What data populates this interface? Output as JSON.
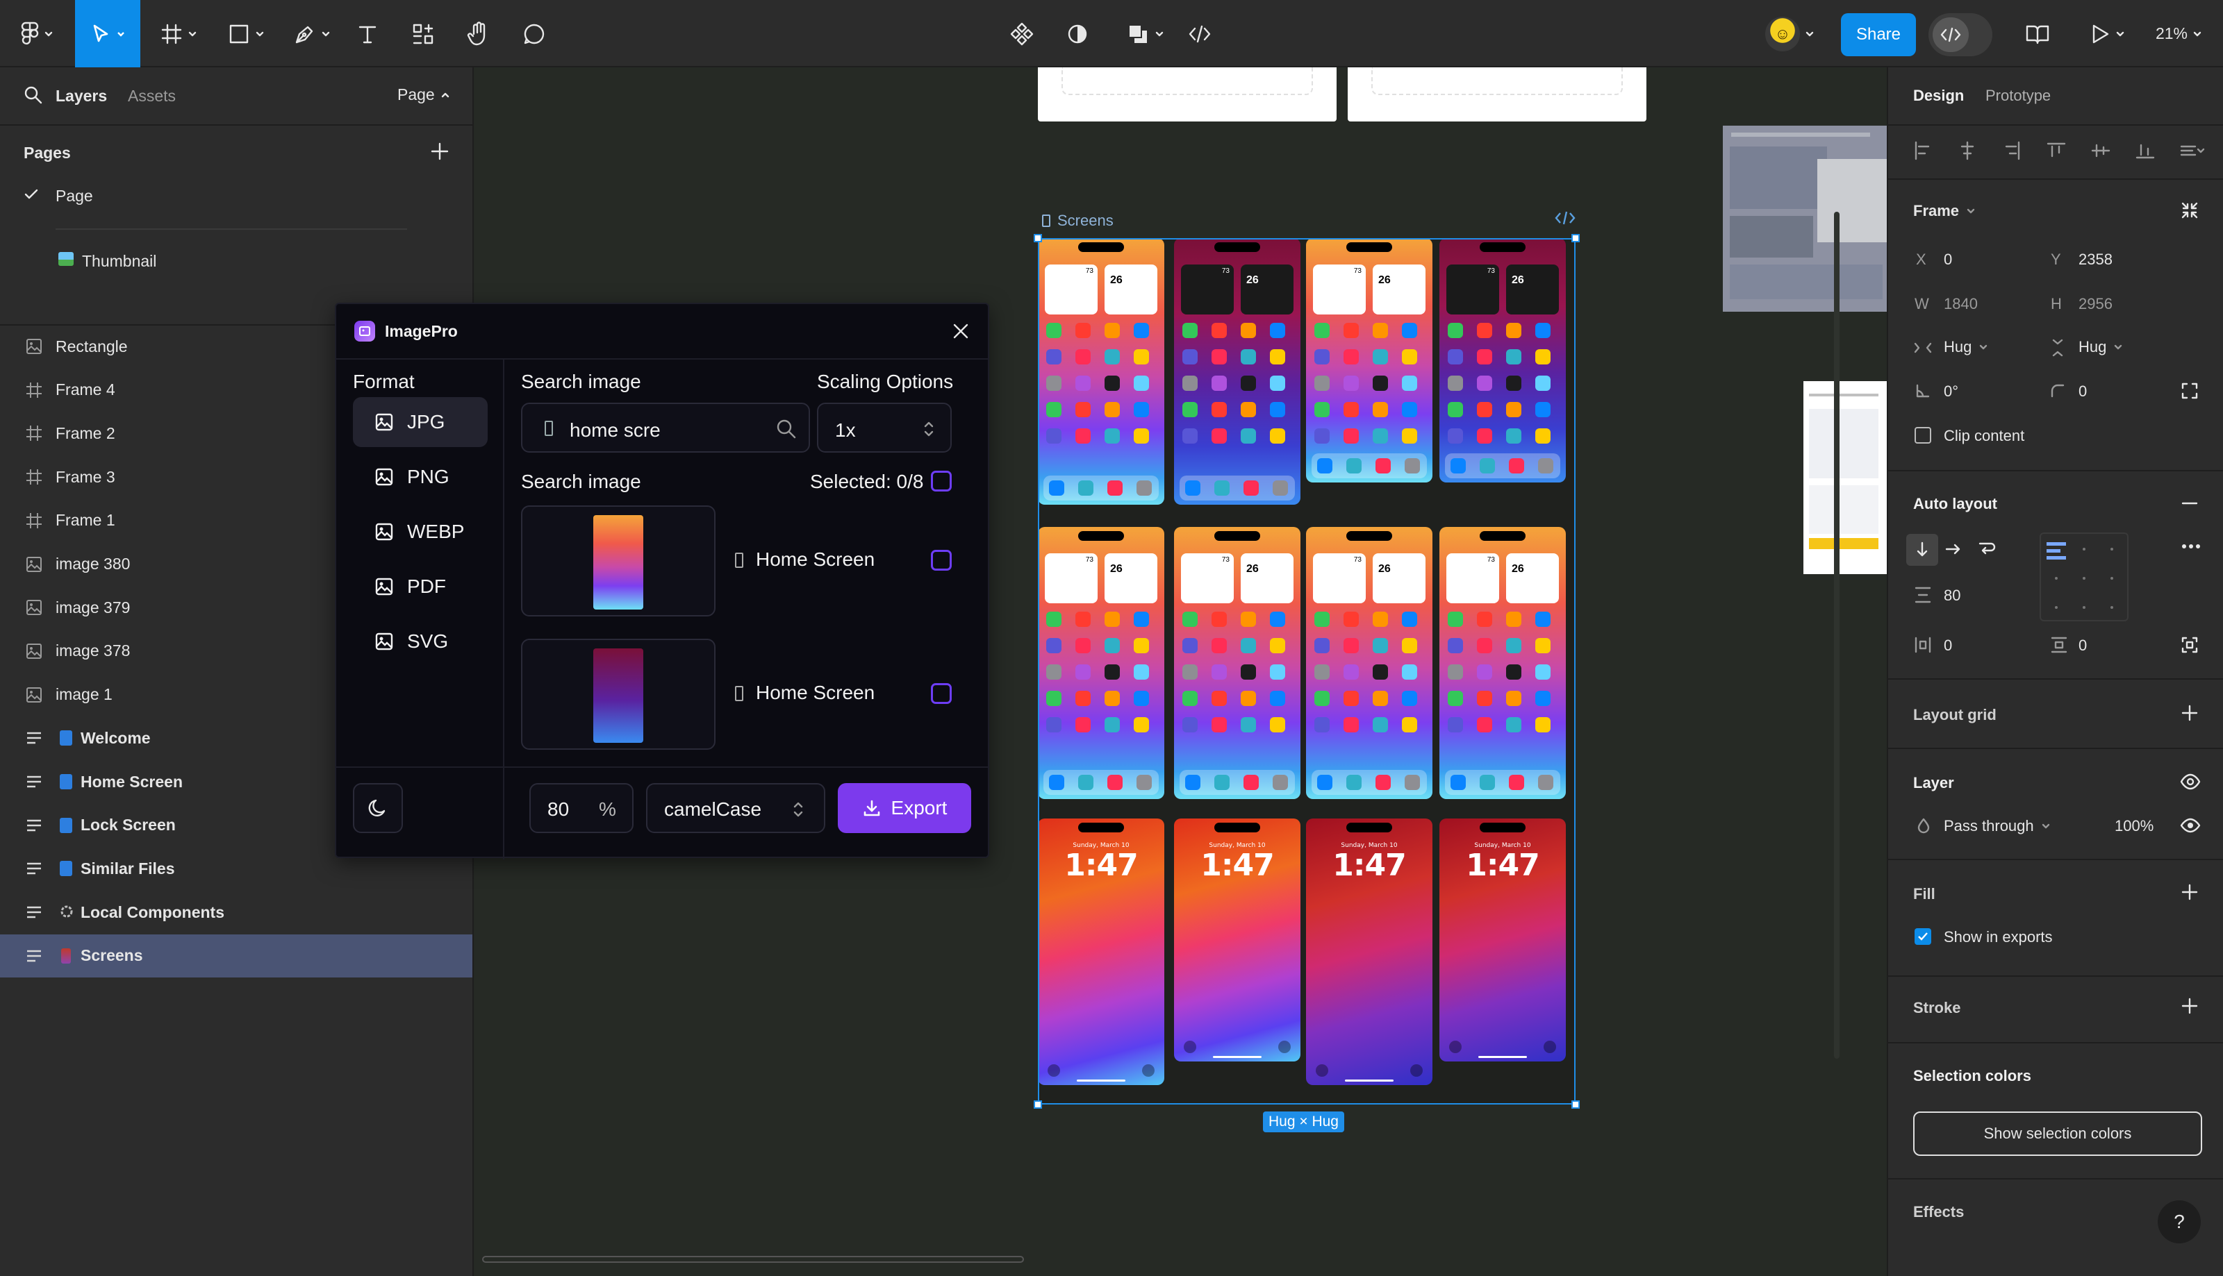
{
  "toolbar": {
    "share_label": "Share",
    "zoom": "21%",
    "avatar_text": "☺"
  },
  "left_panel": {
    "tabs": [
      "Layers",
      "Assets"
    ],
    "page_selector": "Page",
    "pages_title": "Pages",
    "pages": [
      {
        "label": "Page",
        "selected": true
      },
      {
        "label": "Thumbnail",
        "selected": false
      }
    ],
    "layers": [
      {
        "label": "Rectangle",
        "icon": "image-icon",
        "bold": false
      },
      {
        "label": "Frame 4",
        "icon": "frame-icon",
        "bold": false
      },
      {
        "label": "Frame 2",
        "icon": "frame-icon",
        "bold": false
      },
      {
        "label": "Frame 3",
        "icon": "frame-icon",
        "bold": false
      },
      {
        "label": "Frame 1",
        "icon": "frame-icon",
        "bold": false
      },
      {
        "label": "image 380",
        "icon": "image-icon",
        "bold": false
      },
      {
        "label": "image 379",
        "icon": "image-icon",
        "bold": false
      },
      {
        "label": "image 378",
        "icon": "image-icon",
        "bold": false
      },
      {
        "label": "image 1",
        "icon": "image-icon",
        "bold": false
      },
      {
        "label": "Welcome",
        "icon": "autolayout-icon",
        "bold": true
      },
      {
        "label": "Home Screen",
        "icon": "autolayout-icon",
        "bold": true
      },
      {
        "label": "Lock Screen",
        "icon": "autolayout-icon",
        "bold": true
      },
      {
        "label": "Similar Files",
        "icon": "autolayout-icon",
        "bold": true
      },
      {
        "label": "Local Components",
        "icon": "autolayout-icon",
        "bold": true
      },
      {
        "label": "Screens",
        "icon": "autolayout-icon",
        "bold": true,
        "selected": true
      }
    ]
  },
  "imagepro": {
    "title": "ImagePro",
    "format_label": "Format",
    "formats": [
      "JPG",
      "PNG",
      "WEBP",
      "PDF",
      "SVG"
    ],
    "active_format": "JPG",
    "search_label": "Search image",
    "search_value": "home scre",
    "scaling_label": "Scaling Options",
    "scaling_value": "1x",
    "results_label": "Search image",
    "selected_text": "Selected: 0/8",
    "results": [
      {
        "name": "Home Screen"
      },
      {
        "name": "Home Screen"
      }
    ],
    "quality": "80",
    "quality_unit": "%",
    "naming": "camelCase",
    "export_label": "Export"
  },
  "canvas": {
    "frame_label": "Screens",
    "size_badge": "Hug × Hug",
    "lock_time": "1:47",
    "lock_date": "Sunday, March 10",
    "widget_number": "26",
    "widget_count": "73"
  },
  "right_panel": {
    "tabs": [
      "Design",
      "Prototype"
    ],
    "frame_title": "Frame",
    "x_label": "X",
    "x_value": "0",
    "y_label": "Y",
    "y_value": "2358",
    "w_label": "W",
    "w_value": "1840",
    "h_label": "H",
    "h_value": "2956",
    "hug_w": "Hug",
    "hug_h": "Hug",
    "rotation": "0°",
    "radius": "0",
    "clip_content": "Clip content",
    "auto_layout_title": "Auto layout",
    "gap": "80",
    "padding_h": "0",
    "padding_v": "0",
    "layout_grid_title": "Layout grid",
    "layer_title": "Layer",
    "blend_mode": "Pass through",
    "opacity": "100%",
    "fill_title": "Fill",
    "show_in_exports": "Show in exports",
    "stroke_title": "Stroke",
    "selection_colors_title": "Selection colors",
    "show_selection_colors": "Show selection colors",
    "effects_title": "Effects",
    "help": "?"
  },
  "colors": {
    "accent_blue": "#0c8ce9",
    "purple": "#7c3aed",
    "selection_row": "#4a5474"
  }
}
